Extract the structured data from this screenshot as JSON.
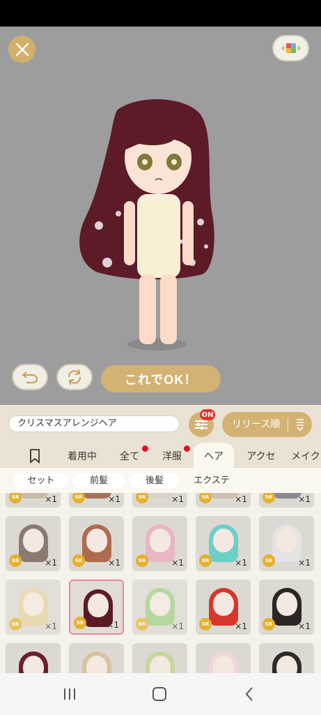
{
  "stage": {
    "confirm_label": "これでOK！"
  },
  "search": {
    "value": "クリスマスアレンジヘア"
  },
  "filter": {
    "badge": "ON"
  },
  "sort": {
    "label": "リリース順"
  },
  "category_tabs": [
    {
      "label": "",
      "icon": "bookmark-icon",
      "has_dot": false
    },
    {
      "label": "着用中",
      "has_dot": false
    },
    {
      "label": "全て",
      "has_dot": true
    },
    {
      "label": "洋服",
      "has_dot": true
    },
    {
      "label": "ヘア",
      "has_dot": false,
      "active": true
    },
    {
      "label": "アクセ",
      "has_dot": false
    },
    {
      "label": "メイク",
      "has_dot": false
    }
  ],
  "sub_tabs": [
    {
      "label": "セット"
    },
    {
      "label": "前髪"
    },
    {
      "label": "後髪"
    },
    {
      "label": "エクステ"
    }
  ],
  "items": {
    "rarity": "SR",
    "count": "×1",
    "hair_colors": [
      "#8a7b70",
      "#b06b4e",
      "#e9b6c5",
      "#6dcfc8",
      "#e4e4e4",
      "#e3d39a",
      "#5a1b24",
      "#9ecf84",
      "#d9362c",
      "#2a2622",
      "#6b1f2b",
      "#d8c3a0",
      "#c6d79a",
      "#f2d6dc",
      "#2d2a2a"
    ],
    "selected_index": 6
  },
  "colors": {
    "accent": "#d3b273",
    "badge_red": "#e5322c",
    "stage_bg": "#9d9d9d"
  }
}
